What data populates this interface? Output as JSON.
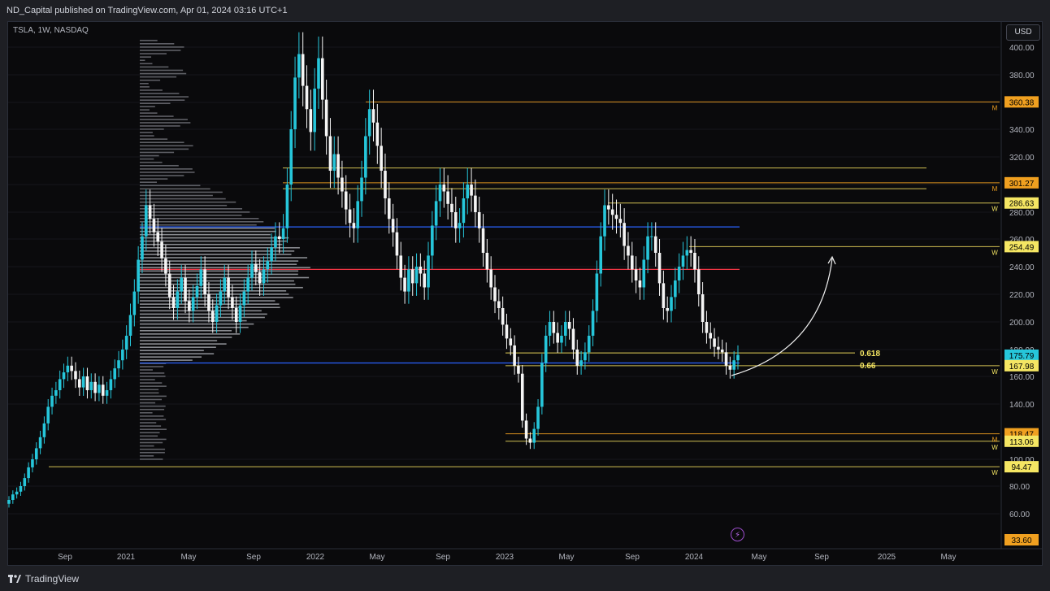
{
  "header": {
    "publisher_text": "ND_Capital published on TradingView.com, Apr 01, 2024 03:16 UTC+1"
  },
  "symbol": {
    "label": "TSLA, 1W, NASDAQ"
  },
  "currency": "USD",
  "footer": {
    "brand": "TradingView"
  },
  "colors": {
    "up": "#26c6da",
    "down": "#f5f5f5",
    "grid": "#15171c",
    "axis_text": "#b2b5be",
    "blue_line": "#2962ff",
    "red_line": "#f23645",
    "yellow_line": "#e6d35a",
    "orange_line": "#f0a020",
    "profile": "#6d6f76",
    "profile_va": "#a0a2a8"
  },
  "chart_data": {
    "type": "candlestick",
    "yaxis": {
      "min": 33.6,
      "max": 410,
      "ticks": [
        60,
        80,
        100,
        140,
        160,
        180,
        200,
        220,
        240,
        260,
        280,
        300,
        320,
        340,
        360,
        380,
        400
      ],
      "tick_labels": [
        "60.00",
        "80.00",
        "100.00",
        "140.00",
        "160.00",
        "180.00",
        "200.00",
        "220.00",
        "240.00",
        "260.00",
        "280.00",
        "300.00",
        "320.00",
        "340.00",
        "360.00",
        "380.00",
        "400.00"
      ]
    },
    "xaxis": {
      "tick_labels": [
        "Sep",
        "2021",
        "May",
        "Sep",
        "2022",
        "May",
        "Sep",
        "2023",
        "May",
        "Sep",
        "2024",
        "May",
        "Sep",
        "2025",
        "May"
      ]
    },
    "price_labels": [
      {
        "value": 360.38,
        "text": "360.38",
        "color": "#f0a020",
        "tf": "M"
      },
      {
        "value": 301.27,
        "text": "301.27",
        "color": "#f0a020",
        "tf": "M"
      },
      {
        "value": 286.63,
        "text": "286.63",
        "color": "#f5e663",
        "tf": "W"
      },
      {
        "value": 254.49,
        "text": "254.49",
        "color": "#f5e663",
        "tf": "W"
      },
      {
        "value": 175.79,
        "text": "175.79",
        "color": "#26c6da",
        "tf": ""
      },
      {
        "value": 167.98,
        "text": "167.98",
        "color": "#f5e663",
        "tf": "W"
      },
      {
        "value": 118.47,
        "text": "118.47",
        "color": "#f0a020",
        "tf": "M"
      },
      {
        "value": 113.06,
        "text": "113.06",
        "color": "#f5e663",
        "tf": "W"
      },
      {
        "value": 94.47,
        "text": "94.47",
        "color": "#f5e663",
        "tf": "W"
      },
      {
        "value": 33.6,
        "text": "33.60",
        "color": "#f0a020",
        "tf": ""
      }
    ],
    "fib_labels": [
      {
        "text": "0.618",
        "value": 177.5
      },
      {
        "text": "0.66",
        "value": 168.5
      }
    ],
    "key_levels": [
      {
        "name": "value-area-high",
        "value": 269,
        "color": "#2962ff"
      },
      {
        "name": "point-of-control",
        "value": 238,
        "color": "#f23645"
      },
      {
        "name": "value-area-low",
        "value": 170,
        "color": "#2962ff"
      }
    ],
    "weekly_closes": [
      70,
      74,
      76,
      80,
      86,
      94,
      100,
      108,
      116,
      126,
      138,
      146,
      150,
      158,
      163,
      168,
      164,
      158,
      152,
      160,
      150,
      156,
      148,
      154,
      146,
      150,
      158,
      166,
      172,
      180,
      190,
      205,
      222,
      245,
      262,
      285,
      275,
      265,
      258,
      246,
      235,
      218,
      210,
      222,
      232,
      215,
      208,
      218,
      226,
      238,
      220,
      208,
      200,
      212,
      222,
      232,
      218,
      210,
      200,
      212,
      222,
      232,
      242,
      236,
      228,
      238,
      244,
      254,
      262,
      260,
      268,
      300,
      340,
      378,
      395,
      372,
      355,
      338,
      370,
      392,
      362,
      335,
      310,
      322,
      305,
      295,
      282,
      272,
      268,
      288,
      305,
      335,
      355,
      345,
      328,
      310,
      290,
      275,
      265,
      248,
      232,
      222,
      238,
      228,
      240,
      235,
      225,
      248,
      270,
      288,
      300,
      295,
      286,
      280,
      268,
      272,
      290,
      300,
      292,
      280,
      268,
      250,
      238,
      225,
      215,
      210,
      198,
      188,
      183,
      168,
      162,
      128,
      115,
      112,
      122,
      138,
      170,
      190,
      200,
      192,
      185,
      190,
      200,
      195,
      180,
      168,
      172,
      178,
      190,
      208,
      235,
      262,
      285,
      282,
      278,
      275,
      272,
      255,
      248,
      238,
      230,
      225,
      245,
      262,
      262,
      250,
      228,
      210,
      208,
      218,
      230,
      240,
      248,
      252,
      250,
      238,
      220,
      200,
      192,
      188,
      182,
      180,
      178,
      168,
      165,
      172,
      176
    ]
  }
}
